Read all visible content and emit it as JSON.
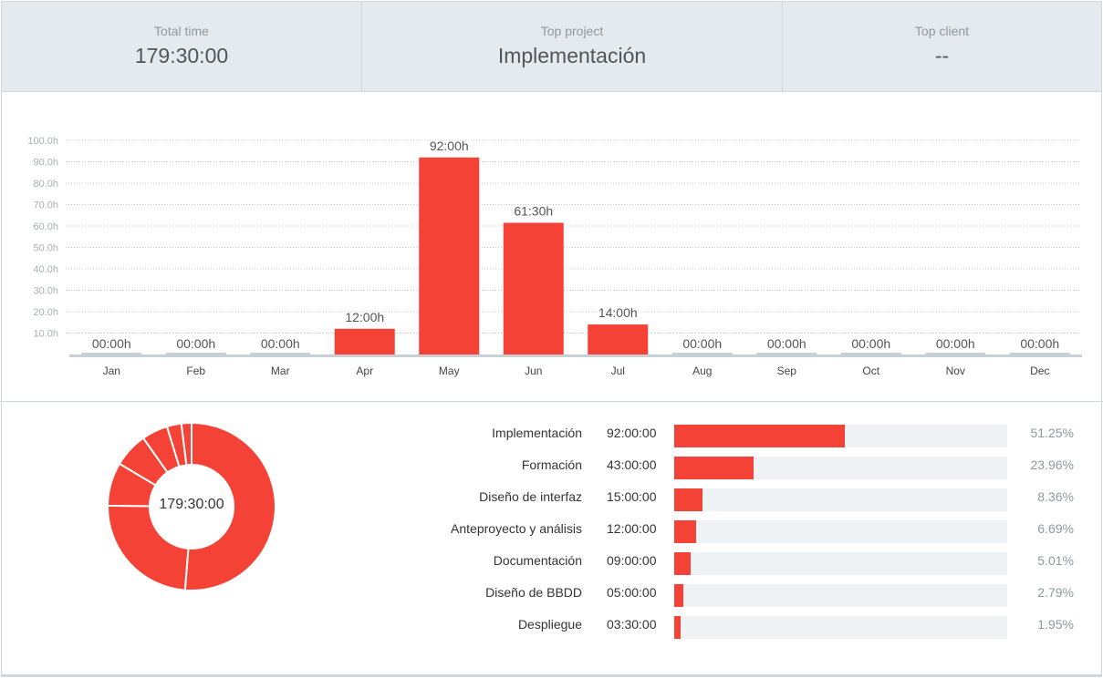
{
  "stats": {
    "total_time_label": "Total time",
    "total_time_value": "179:30:00",
    "top_project_label": "Top project",
    "top_project_value": "Implementación",
    "top_client_label": "Top client",
    "top_client_value": "--"
  },
  "chart_data": {
    "type": "bar",
    "categories": [
      "Jan",
      "Feb",
      "Mar",
      "Apr",
      "May",
      "Jun",
      "Jul",
      "Aug",
      "Sep",
      "Oct",
      "Nov",
      "Dec"
    ],
    "values": [
      0,
      0,
      0,
      12,
      92,
      61.5,
      14,
      0,
      0,
      0,
      0,
      0
    ],
    "value_labels": [
      "00:00h",
      "00:00h",
      "00:00h",
      "12:00h",
      "92:00h",
      "61:30h",
      "14:00h",
      "00:00h",
      "00:00h",
      "00:00h",
      "00:00h",
      "00:00h"
    ],
    "yticks": [
      "10.0h",
      "20.0h",
      "30.0h",
      "40.0h",
      "50.0h",
      "60.0h",
      "70.0h",
      "80.0h",
      "90.0h",
      "100.0h"
    ],
    "ylim": [
      0,
      100
    ],
    "grid": true,
    "bar_color": "#f44336"
  },
  "donut": {
    "center_label": "179:30:00",
    "color": "#f44336"
  },
  "projects": [
    {
      "name": "Implementación",
      "time": "92:00:00",
      "percent": "51.25%",
      "fraction": 0.5125
    },
    {
      "name": "Formación",
      "time": "43:00:00",
      "percent": "23.96%",
      "fraction": 0.2396
    },
    {
      "name": "Diseño de interfaz",
      "time": "15:00:00",
      "percent": "8.36%",
      "fraction": 0.0836
    },
    {
      "name": "Anteproyecto y análisis",
      "time": "12:00:00",
      "percent": "6.69%",
      "fraction": 0.0669
    },
    {
      "name": "Documentación",
      "time": "09:00:00",
      "percent": "5.01%",
      "fraction": 0.0501
    },
    {
      "name": "Diseño de BBDD",
      "time": "05:00:00",
      "percent": "2.79%",
      "fraction": 0.0279
    },
    {
      "name": "Despliegue",
      "time": "03:30:00",
      "percent": "1.95%",
      "fraction": 0.0195
    }
  ]
}
